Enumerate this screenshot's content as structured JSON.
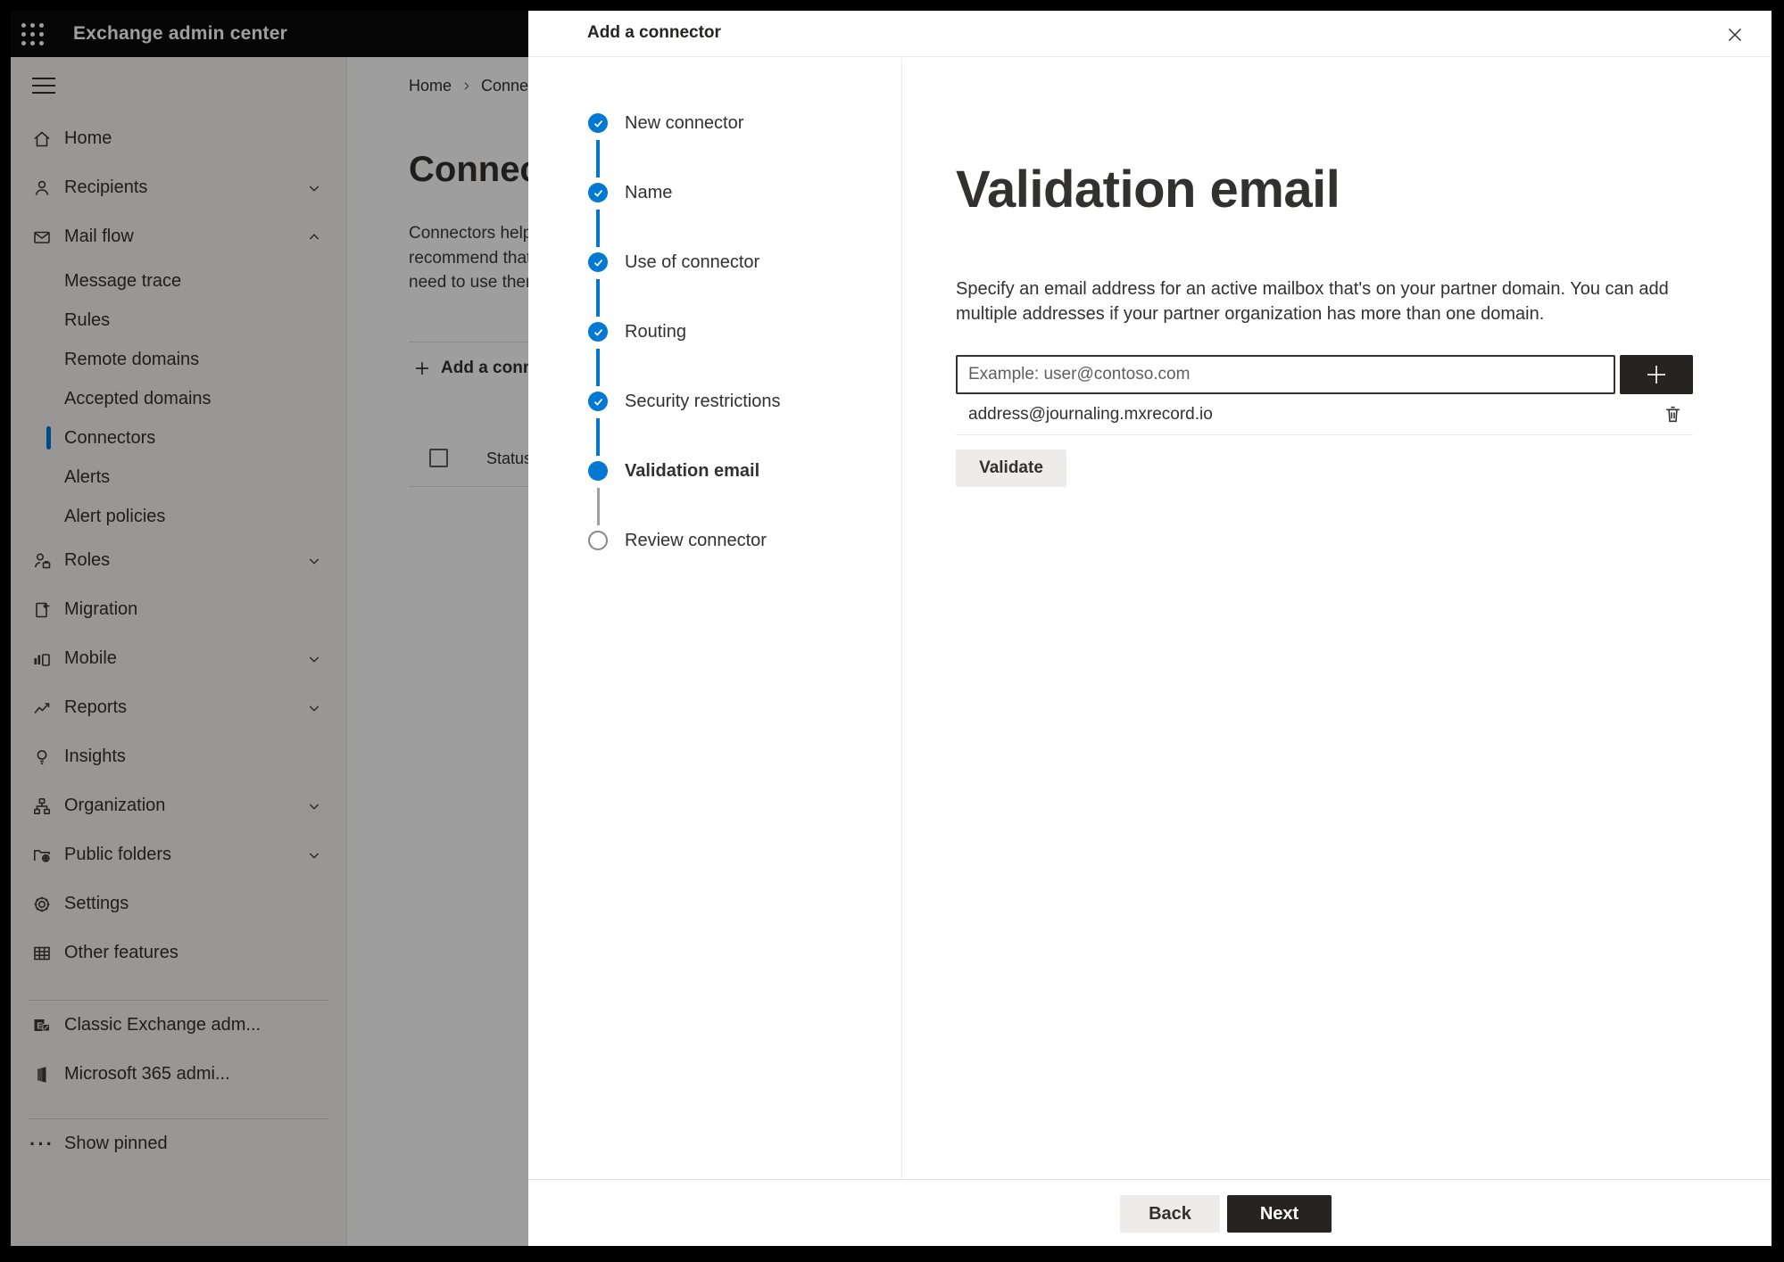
{
  "app": {
    "title": "Exchange admin center"
  },
  "sidebar": {
    "items": [
      "Home",
      "Recipients",
      "Mail flow",
      "Message trace",
      "Rules",
      "Remote domains",
      "Accepted domains",
      "Connectors",
      "Alerts",
      "Alert policies",
      "Roles",
      "Migration",
      "Mobile",
      "Reports",
      "Insights",
      "Organization",
      "Public folders",
      "Settings",
      "Other features"
    ],
    "footer_items": [
      "Classic Exchange adm...",
      "Microsoft 365 admi..."
    ],
    "show_pinned": "Show pinned"
  },
  "page": {
    "breadcrumb": {
      "home": "Home",
      "current": "Conne"
    },
    "title": "Connect",
    "description_lines": [
      "Connectors help",
      "recommend that",
      "need to use them"
    ],
    "toolbar": {
      "add_label": "Add a conn"
    },
    "table": {
      "status_header": "Status"
    }
  },
  "modal": {
    "title": "Add a connector",
    "steps": [
      {
        "label": "New connector",
        "state": "done"
      },
      {
        "label": "Name",
        "state": "done"
      },
      {
        "label": "Use of connector",
        "state": "done"
      },
      {
        "label": "Routing",
        "state": "done"
      },
      {
        "label": "Security restrictions",
        "state": "done"
      },
      {
        "label": "Validation email",
        "state": "current"
      },
      {
        "label": "Review connector",
        "state": "todo"
      }
    ],
    "content": {
      "heading": "Validation email",
      "description_lines": [
        "Specify an email address for an active mailbox that's on your partner domain. You can add multiple addresses if your partner organization has more than one domain."
      ],
      "input_placeholder": "Example: user@contoso.com",
      "addresses": [
        "address@journaling.mxrecord.io"
      ],
      "validate_label": "Validate"
    },
    "footer": {
      "back_label": "Back",
      "next_label": "Next"
    }
  },
  "colors": {
    "accent": "#0078d4",
    "primary_button": "#252423",
    "topbar": "#0a0a0a",
    "dim_overlay": "rgba(0,0,0,0.38)"
  }
}
